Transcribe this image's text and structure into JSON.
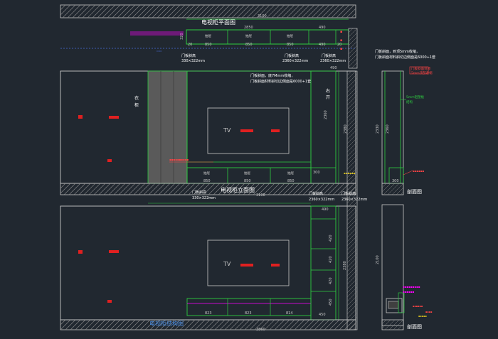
{
  "titles": {
    "plan": "电视柜平面图",
    "elevation": "电视柜立面图",
    "structure": "电视柜结构图",
    "section_a": "剖面图",
    "section_b": "剖面图"
  },
  "notes": {
    "top_a": "门板斜面，到顶5mm收缩，",
    "top_b": "门板斜面材料斜切边侧面是6000+1套",
    "mid_a": "门板斜面，底7Mmm收缩，",
    "mid_b": "门板斜面材料斜切边侧面是6000+1套",
    "side_red_a": "门板斜面到顶",
    "side_red_b": "5mm顶部收缩",
    "side_green_a": "5mm铝塑板",
    "side_green_b": "结构"
  },
  "labels": {
    "tv_elev": "TV",
    "tv_struct": "TV",
    "door_a": "门板斜高",
    "door_a_size": "330×322mm",
    "door_b": "门板斜高",
    "door_b_size": "2360×322mm",
    "door_c": "门板斜高",
    "door_c_size": "2360×322mm",
    "door_d": "门板斜高",
    "door_d_size": "330×322mm",
    "door_e": "门板斜高",
    "door_e_size": "2360×322mm",
    "door_f": "门板斜高",
    "door_f_size": "2360×322mm",
    "door_plan": "抽屉",
    "wardrobe_a": "衣",
    "wardrobe_b": "柜",
    "right_open_a": "右",
    "right_open_b": "开"
  },
  "dims": {
    "plan_total": "3100",
    "plan_inner": "2850",
    "plan_sub": "490",
    "plan_20a": "20",
    "plan_20b": "20",
    "plan_20c": "20",
    "plan_850a": "850",
    "plan_850b": "850",
    "plan_850c": "850",
    "plan_490": "490",
    "plan_320": "320",
    "elev_total": "3100",
    "elev_850a": "850",
    "elev_850b": "850",
    "elev_850c": "850",
    "elev_490": "490",
    "elev_h1": "2360",
    "elev_h2": "2380",
    "elev_300": "300",
    "struct_total": "3860",
    "struct_823a": "823",
    "struct_823b": "823",
    "struct_814": "814",
    "struct_450": "450",
    "struct_h": "2380",
    "sec_h1": "2330",
    "sec_h2": "2360",
    "sec_h3": "2100",
    "sec_300": "300",
    "sec_20": "20"
  },
  "structure_shelves": [
    "490",
    "420",
    "420",
    "420",
    "450"
  ]
}
